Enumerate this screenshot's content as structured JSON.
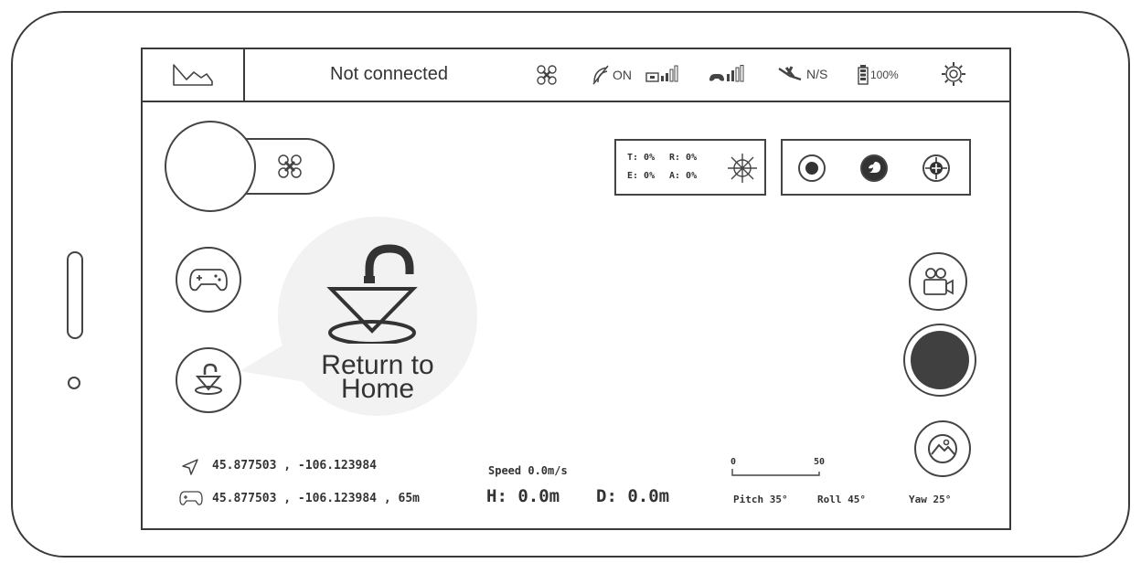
{
  "topbar": {
    "status": "Not connected",
    "icons": [
      "drone-icon",
      "gps-toggle-icon",
      "video-signal-icon",
      "remote-signal-icon",
      "satellite-icon",
      "battery-icon",
      "settings-gear-icon"
    ],
    "gps_state": "ON",
    "satellite_state": "N/S",
    "battery": "100%"
  },
  "trim": {
    "t": "T: 0%",
    "r": "R: 0%",
    "e": "E: 0%",
    "a": "A: 0%"
  },
  "tooltip": {
    "title_line1": "Return to",
    "title_line2": "Home"
  },
  "telemetry": {
    "drone_coords": "45.877503 , -106.123984",
    "remote_coords": "45.877503 , -106.123984 , 65m",
    "speed": "Speed 0.0m/s",
    "height": "H: 0.0m",
    "distance": "D: 0.0m",
    "scale_min": "0",
    "scale_max": "50",
    "pitch": "Pitch 35°",
    "roll": "Roll 45°",
    "yaw": "Yaw 25°"
  },
  "colors": {
    "line": "#3a3a3a",
    "shutter_fill": "#404040",
    "bubble": "#f2f2f2"
  }
}
